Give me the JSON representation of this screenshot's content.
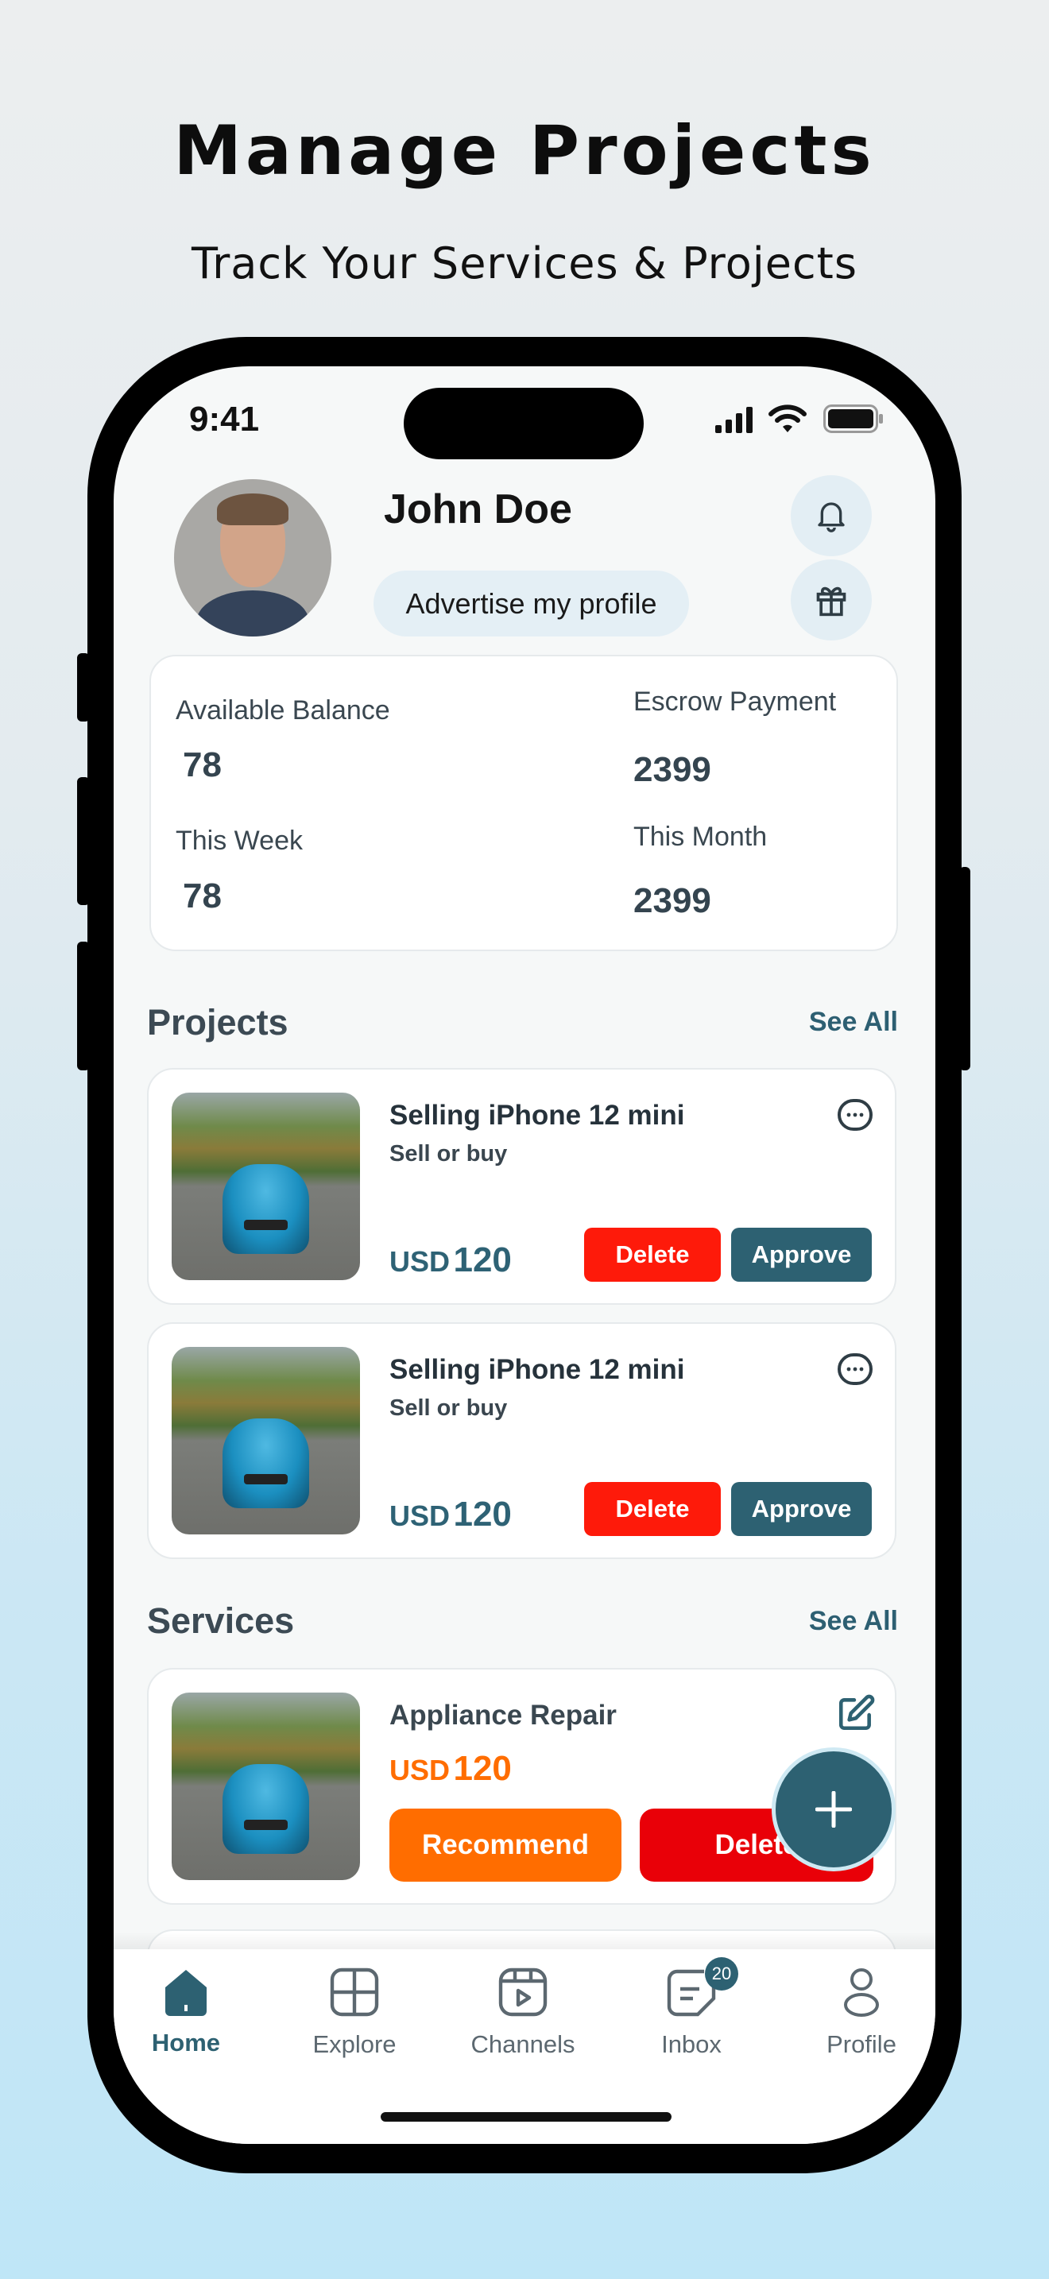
{
  "promo": {
    "title": "Manage Projects",
    "subtitle": "Track Your Services & Projects"
  },
  "status_bar": {
    "time": "9:41"
  },
  "profile": {
    "name": "John Doe",
    "advertise_label": "Advertise my profile"
  },
  "stats": [
    {
      "label": "Available Balance",
      "value": "78"
    },
    {
      "label": "Escrow Payment",
      "value": "2399"
    },
    {
      "label": "This Week",
      "value": "78"
    },
    {
      "label": "This Month",
      "value": "2399"
    }
  ],
  "projects": {
    "heading": "Projects",
    "see_all": "See All",
    "items": [
      {
        "title": "Selling iPhone 12 mini",
        "subtitle": "Sell or buy",
        "currency": "USD",
        "amount": "120",
        "delete": "Delete",
        "approve": "Approve"
      },
      {
        "title": "Selling iPhone 12 mini",
        "subtitle": "Sell or buy",
        "currency": "USD",
        "amount": "120",
        "delete": "Delete",
        "approve": "Approve"
      }
    ]
  },
  "services": {
    "heading": "Services",
    "see_all": "See All",
    "items": [
      {
        "title": "Appliance Repair",
        "currency": "USD",
        "amount": "120",
        "recommend": "Recommend",
        "delete": "Delete"
      }
    ]
  },
  "nav": {
    "items": [
      {
        "label": "Home",
        "icon": "home-icon",
        "active": true
      },
      {
        "label": "Explore",
        "icon": "grid-icon"
      },
      {
        "label": "Channels",
        "icon": "video-icon"
      },
      {
        "label": "Inbox",
        "icon": "inbox-icon",
        "badge": "20"
      },
      {
        "label": "Profile",
        "icon": "user-icon"
      }
    ]
  },
  "colors": {
    "primary": "#2d6172",
    "delete": "#fe1a0a",
    "recommend": "#ff6d00",
    "service_price": "#ff6d00"
  }
}
